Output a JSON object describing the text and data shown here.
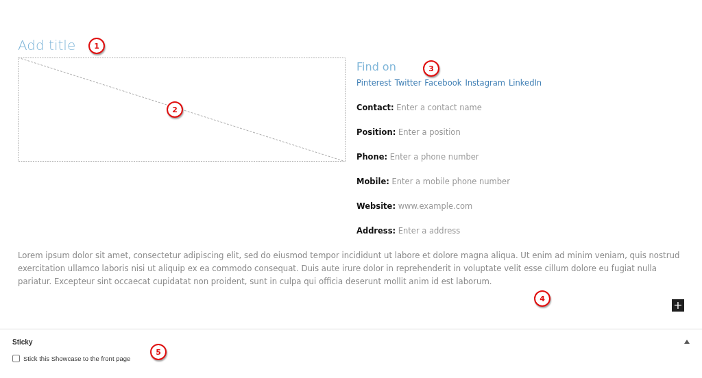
{
  "editor": {
    "title_placeholder": "Add title",
    "find_on": {
      "heading": "Find on",
      "links": [
        "Pinterest",
        "Twitter",
        "Facebook",
        "Instagram",
        "LinkedIn"
      ]
    },
    "fields": [
      {
        "label": "Contact:",
        "placeholder": "Enter a contact name"
      },
      {
        "label": "Position:",
        "placeholder": "Enter a position"
      },
      {
        "label": "Phone:",
        "placeholder": "Enter a phone number"
      },
      {
        "label": "Mobile:",
        "placeholder": "Enter a mobile phone number"
      },
      {
        "label": "Website:",
        "placeholder": "www.example.com"
      },
      {
        "label": "Address:",
        "placeholder": "Enter a address"
      }
    ],
    "description": "Lorem ipsum dolor sit amet, consectetur adipiscing elit, sed do eiusmod tempor incididunt ut labore et dolore magna aliqua. Ut enim ad minim veniam, quis nostrud exercitation ullamco laboris nisi ut aliquip ex ea commodo consequat. Duis aute irure dolor in reprehenderit in voluptate velit esse cillum dolore eu fugiat nulla pariatur. Excepteur sint occaecat cupidatat non proident, sunt in culpa qui officia deserunt mollit anim id est laborum.",
    "add_block": "+"
  },
  "sticky_panel": {
    "title": "Sticky",
    "expanded": true,
    "checkbox": {
      "label": "Stick this Showcase to the front page",
      "checked": false
    }
  },
  "callouts": [
    "1",
    "2",
    "3",
    "4",
    "5"
  ]
}
